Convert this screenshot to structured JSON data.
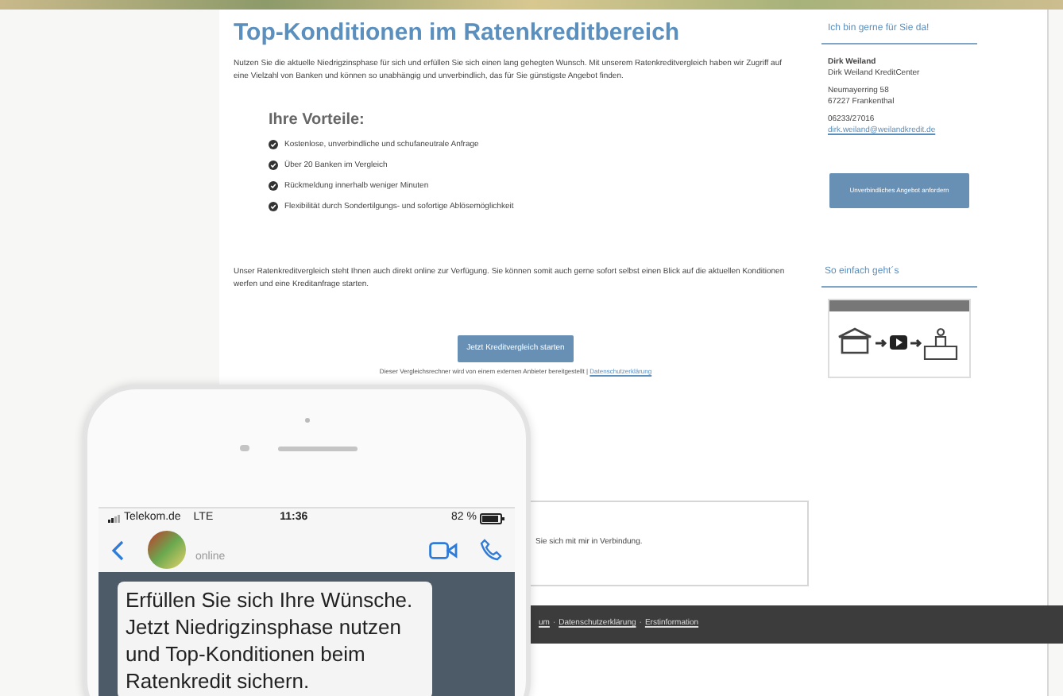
{
  "main": {
    "title": "Top-Konditionen im Ratenkreditbereich",
    "intro": "Nutzen Sie die aktuelle Niedrigzinsphase für sich und erfüllen Sie sich einen lang gehegten Wunsch. Mit unserem Ratenkreditvergleich haben wir Zugriff auf eine Vielzahl von Banken und können so unabhängig und unverbindlich, das für Sie günstigste Angebot finden.",
    "benefits_title": "Ihre Vorteile:",
    "benefits": [
      "Kostenlose, unverbindliche und schufaneutrale Anfrage",
      "Über 20 Banken im Vergleich",
      "Rückmeldung innerhalb weniger Minuten",
      "Flexibilität durch Sondertilgungs- und sofortige Ablösemöglichkeit"
    ],
    "online_text": "Unser Ratenkreditvergleich steht Ihnen auch direkt online zur Verfügung. Sie können somit auch gerne sofort selbst einen Blick auf die aktuellen Konditionen werfen und eine Kreditanfrage starten.",
    "compare_button": "Jetzt Kreditvergleich starten",
    "disclaimer": "Dieser Vergleichsrechner wird von einem externen Anbieter bereitgestellt",
    "disclaimer_separator": "|",
    "disclaimer_link": "Datenschutzerklärung",
    "contact_box_text": "Sie sich mit mir in Verbindung."
  },
  "sidebar": {
    "contact_title": "Ich bin gerne für Sie da!",
    "name": "Dirk Weiland",
    "company": "Dirk Weiland KreditCenter",
    "street": "Neumayerring 58",
    "city": "67227 Frankenthal",
    "phone": "06233/27016",
    "email": "dirk.weiland@weilandkredit.de",
    "offer_button": "Unverbindliches Angebot anfordern",
    "howto_title": "So einfach geht´s"
  },
  "footer": {
    "links": [
      "um",
      "Datenschutzerklärung",
      "Erstinformation"
    ],
    "separator": "·"
  },
  "phone": {
    "carrier": "Telekom.de",
    "network": "LTE",
    "time": "11:36",
    "battery": "82 %",
    "contact_status": "online",
    "message": "Erfüllen Sie sich Ihre Wünsche. Jetzt Niedrigzinsphase nutzen und Top-Konditionen beim Ratenkredit sichern."
  }
}
